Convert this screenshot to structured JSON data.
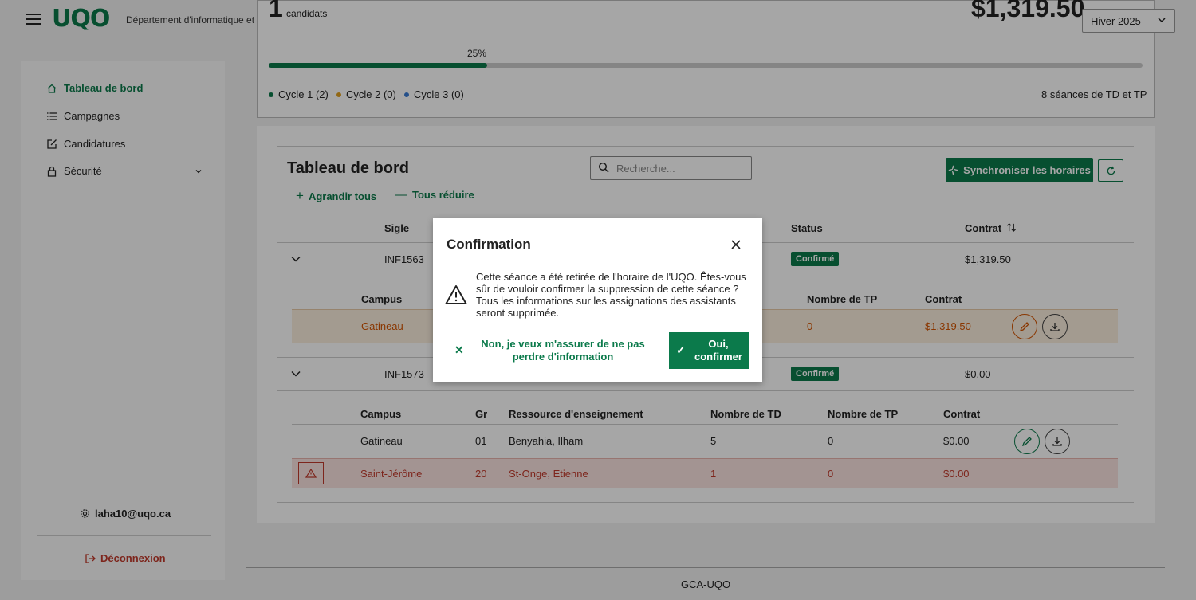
{
  "header": {
    "logo": "UQO",
    "department": "Département d'informatique et d'ingénierie",
    "season": "Hiver 2025"
  },
  "sidebar": {
    "items": [
      {
        "label": "Tableau de bord",
        "icon": "home-icon",
        "active": true
      },
      {
        "label": "Campagnes",
        "icon": "list-icon",
        "active": false
      },
      {
        "label": "Candidatures",
        "icon": "edit-icon",
        "active": false
      },
      {
        "label": "Sécurité",
        "icon": "lock-icon",
        "active": false
      }
    ],
    "user": "laha10@uqo.ca",
    "logout": "Déconnexion"
  },
  "summary": {
    "count": "1",
    "count_label": "candidats",
    "amount": "$1,319.50",
    "progress_label": "25%",
    "progress": 0.25,
    "cycles": [
      {
        "label": "Cycle 1 (2)",
        "color": "#0b7a4b"
      },
      {
        "label": "Cycle 2 (0)",
        "color": "#e0a020"
      },
      {
        "label": "Cycle 3 (0)",
        "color": "#3a7bd5"
      }
    ],
    "sessions": "8 séances de TD et TP"
  },
  "dashboard": {
    "title": "Tableau de bord",
    "search_placeholder": "Recherche...",
    "sync_label": "Synchroniser les horaires",
    "expand_all": "Agrandir tous",
    "collapse_all": "Tous réduire",
    "columns": {
      "sigle": "Sigle",
      "status": "Status",
      "contrat": "Contrat"
    },
    "courses": [
      {
        "sigle": "INF1563",
        "status": "Confirmé",
        "contrat": "$1,319.50",
        "sub_columns": {
          "campus": "Campus",
          "nb_tp": "Nombre de TP",
          "contrat": "Contrat"
        },
        "rows": [
          {
            "campus": "Gatineau",
            "nb_tp": "0",
            "contrat": "$1,319.50"
          }
        ]
      },
      {
        "sigle": "INF1573",
        "status": "Confirmé",
        "contrat": "$0.00",
        "sub_columns": {
          "campus": "Campus",
          "gr": "Gr",
          "ressource": "Ressource d'enseignement",
          "nb_td": "Nombre de TD",
          "nb_tp": "Nombre de TP",
          "contrat": "Contrat"
        },
        "rows": [
          {
            "campus": "Gatineau",
            "gr": "01",
            "ressource": "Benyahia, Ilham",
            "nb_td": "5",
            "nb_tp": "0",
            "contrat": "$0.00"
          },
          {
            "campus": "Saint-Jérôme",
            "gr": "20",
            "ressource": "St-Onge, Etienne",
            "nb_td": "1",
            "nb_tp": "0",
            "contrat": "$0.00"
          }
        ]
      }
    ]
  },
  "footer": "GCA-UQO",
  "modal": {
    "title": "Confirmation",
    "message": "Cette séance a été retirée de l'horaire de l'UQO. Êtes-vous sûr de vouloir confirmer la suppression de cette séance ? Tous les informations sur les assignations des assistants seront supprimée.",
    "no_label": "Non, je veux m'assurer de ne pas perdre d'information",
    "yes_label": "Oui, confirmer"
  }
}
